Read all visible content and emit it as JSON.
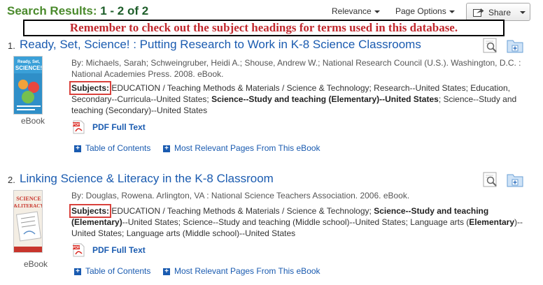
{
  "header": {
    "title": "Search Results:",
    "range": "1 - 2 of 2",
    "relevance": "Relevance",
    "page_options": "Page Options",
    "share": "Share"
  },
  "banner": "Remember to check out the subject headings for terms used in this database.",
  "results": [
    {
      "number": "1.",
      "title": "Ready, Set, Science! : Putting Research to Work in K-8 Science Classrooms",
      "byline": "By: Michaels, Sarah; Schweingruber, Heidi A.; Shouse, Andrew W.; National Research Council (U.S.). Washington, D.C. : National Academies Press. 2008. eBook.",
      "subjects_label": "Subjects:",
      "subjects_pre": " EDUCATION / Teaching Methods & Materials / Science & Technology; Research--United States; Education, Secondary--Curricula--United States; ",
      "subjects_bold": "Science--Study and teaching (Elementary)--United States",
      "subjects_post": "; Science--Study and teaching (Secondary)--United States",
      "type": "eBook",
      "pdf_label": "PDF Full Text",
      "link_toc": "Table of Contents",
      "link_pages": "Most Relevant Pages From This eBook",
      "cover_text": "Ready, Set, SCIENCE!"
    },
    {
      "number": "2.",
      "title": "Linking Science & Literacy in the K-8 Classroom",
      "byline": "By: Douglas, Rowena. Arlington, VA : National Science Teachers Association. 2006. eBook.",
      "subjects_label": "Subjects:",
      "subjects_pre": " EDUCATION / Teaching Methods & Materials / Science & Technology; ",
      "subjects_bold": "Science--Study and teaching (Elementary)",
      "subjects_post": "--United States; Science--Study and teaching (Middle school)--United States; Language arts (",
      "subjects_bold2": "Elementary",
      "subjects_post2": ")--United States; Language arts (Middle school)--United States",
      "type": "eBook",
      "pdf_label": "PDF Full Text",
      "link_toc": "Table of Contents",
      "link_pages": "Most Relevant Pages From This eBook",
      "cover_text": "SCIENCE & LITERACY"
    }
  ],
  "colors": {
    "title_green": "#4a8a2c",
    "link_blue": "#1a5bb0",
    "banner_red": "#c0282d",
    "highlight_red": "#d9413c"
  },
  "icons": [
    "share-icon",
    "pdf-icon",
    "plus-icon",
    "preview-icon",
    "folder-add-icon",
    "caret-down-icon"
  ]
}
